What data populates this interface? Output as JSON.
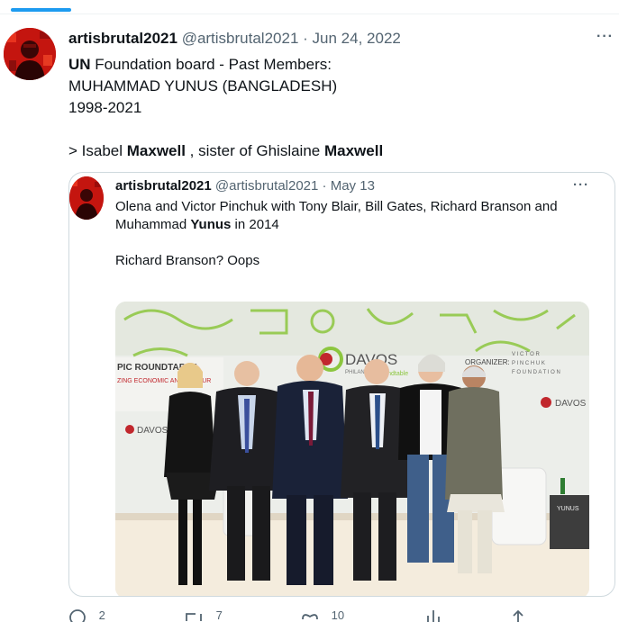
{
  "tweet": {
    "display_name": "artisbrutal2021",
    "handle": "@artisbrutal2021",
    "separator": "·",
    "date": "Jun 24, 2022",
    "more_label": "···",
    "line1_bold": "UN",
    "line1_rest": " Foundation board - Past Members:",
    "line2": "MUHAMMAD YUNUS (BANGLADESH)",
    "line3": "1998-2021",
    "line5_a": "> Isabel ",
    "line5_b": "Maxwell",
    "line5_c": " , sister of Ghislaine ",
    "line5_d": "Maxwell"
  },
  "quote": {
    "display_name": "artisbrutal2021",
    "handle": "@artisbrutal2021",
    "separator": "·",
    "date": "May 13",
    "more_label": "···",
    "line1": "Olena and Victor Pinchuk with Tony Blair, Bill Gates, Richard Branson and",
    "line2_a": "Muhammad ",
    "line2_b": "Yunus",
    "line2_c": " in 2014",
    "line4": "Richard Branson? Oops"
  },
  "photo": {
    "banner_left_1": "PIC ROUNDTABLE",
    "banner_left_2": "ZING ECONOMIC AN   AL RETUR",
    "davos_1": "DAVOS",
    "davos_2": "PHILANTHROPIC",
    "davos_3": "roundtable",
    "organizer": "ORGANIZER:",
    "org_1": "V I C T O R",
    "org_2": "P I N C H U K",
    "org_3": "F O U N D A T I O N",
    "small_davos": "DAVOS",
    "yunus_tag": "YUNUS"
  },
  "actions": {
    "replies": "2",
    "reposts": "7",
    "likes": "10"
  },
  "colors": {
    "accent": "#1d9bf0",
    "muted": "#536471",
    "border": "#cfd9de"
  }
}
